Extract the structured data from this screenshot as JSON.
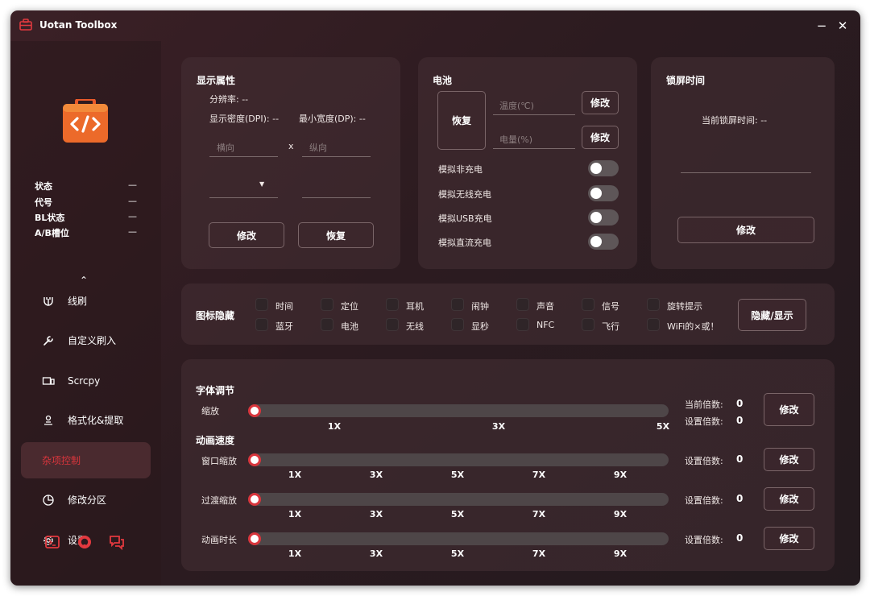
{
  "app": {
    "title": "Uotan Toolbox",
    "minimize": "−",
    "close": "✕"
  },
  "accent": "#d8353c",
  "device": {
    "status_label": "状态",
    "status_value": "—",
    "codename_label": "代号",
    "codename_value": "—",
    "bl_label": "BL状态",
    "bl_value": "—",
    "ab_label": "A/B槽位",
    "ab_value": "—"
  },
  "sidebar": {
    "collapse_icon": "chevron-up-icon",
    "items": [
      {
        "label": "线刷",
        "icon": "flash-icon"
      },
      {
        "label": "自定义刷入",
        "icon": "wrench-icon"
      },
      {
        "label": "Scrcpy",
        "icon": "screen-mirror-icon"
      },
      {
        "label": "格式化&提取",
        "icon": "user-extract-icon"
      },
      {
        "label": "杂项控制",
        "icon": "",
        "active": true
      },
      {
        "label": "修改分区",
        "icon": "pie-icon"
      },
      {
        "label": "设置",
        "icon": "gear-icon"
      }
    ],
    "bottom": [
      "terminal-icon",
      "github-icon",
      "chat-icon"
    ]
  },
  "display": {
    "title": "显示属性",
    "resolution": "分辨率: --",
    "dpi": "显示密度(DPI): --",
    "dp": "最小宽度(DP): --",
    "width_placeholder": "横向",
    "x": "x",
    "height_placeholder": "纵向",
    "modify": "修改",
    "restore": "恢复"
  },
  "battery": {
    "title": "电池",
    "restore": "恢复",
    "temp_placeholder": "温度(℃)",
    "level_placeholder": "电量(%)",
    "modify1": "修改",
    "modify2": "修改",
    "toggles": [
      {
        "label": "模拟非充电",
        "on": false
      },
      {
        "label": "模拟无线充电",
        "on": false
      },
      {
        "label": "模拟USB充电",
        "on": false
      },
      {
        "label": "模拟直流充电",
        "on": false
      }
    ]
  },
  "lock": {
    "title": "锁屏时间",
    "current": "当前锁屏时间: --",
    "modify": "修改"
  },
  "icons": {
    "title": "图标隐藏",
    "items": [
      "时间",
      "定位",
      "耳机",
      "闹钟",
      "声音",
      "信号",
      "旋转提示",
      "蓝牙",
      "电池",
      "无线",
      "显秒",
      "NFC",
      "飞行",
      "WiFi的×或！"
    ],
    "action": "隐藏/显示"
  },
  "font": {
    "title": "字体调节",
    "scale_label": "缩放",
    "ticks": [
      "1X",
      "3X",
      "5X"
    ],
    "current_label": "当前倍数:",
    "current_value": "0",
    "set_label": "设置倍数:",
    "set_value": "0",
    "modify": "修改"
  },
  "anim": {
    "title": "动画速度",
    "ticks": [
      "1X",
      "3X",
      "5X",
      "7X",
      "9X"
    ],
    "rows": [
      {
        "label": "窗口缩放",
        "set_label": "设置倍数:",
        "value": "0",
        "modify": "修改"
      },
      {
        "label": "过渡缩放",
        "set_label": "设置倍数:",
        "value": "0",
        "modify": "修改"
      },
      {
        "label": "动画时长",
        "set_label": "设置倍数:",
        "value": "0",
        "modify": "修改"
      }
    ]
  }
}
